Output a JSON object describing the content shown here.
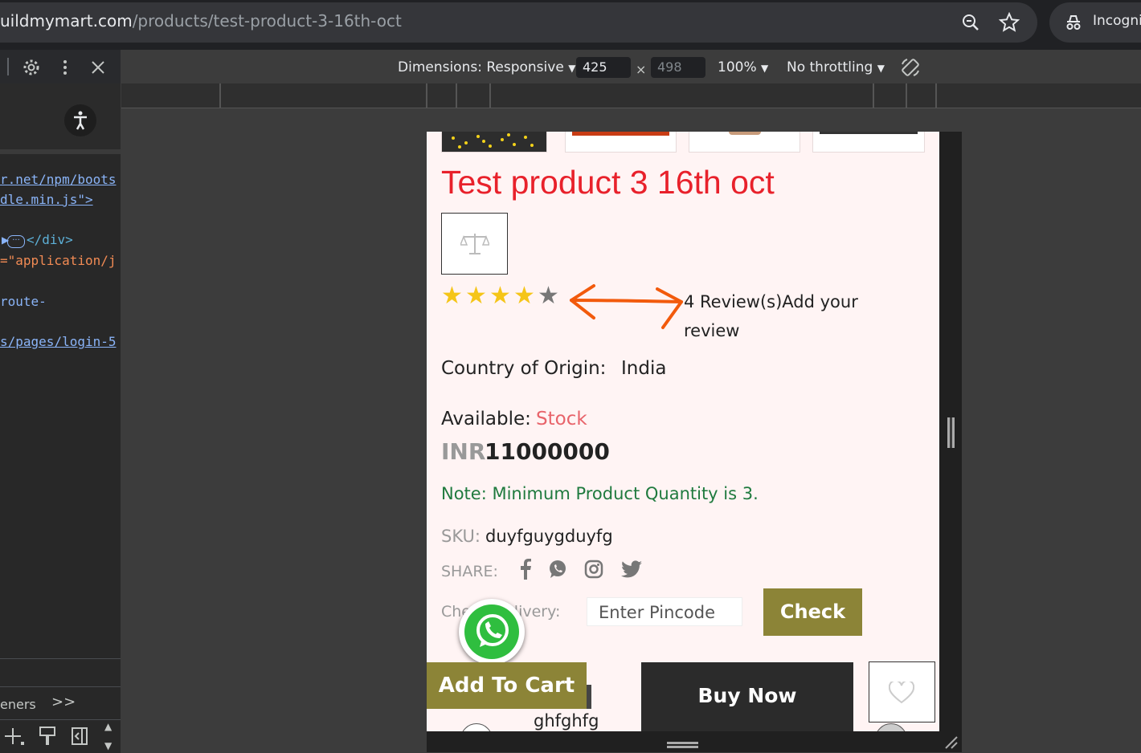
{
  "browser": {
    "url_host": "uildmymart.com",
    "url_path": "/products/test-product-3-16th-oct",
    "incognito_label": "Incogni"
  },
  "devtools": {
    "code_lines": [
      {
        "text": "r.net/npm/boots",
        "kind": "link"
      },
      {
        "text": "dle.min.js\">",
        "kind": "link"
      },
      {
        "text": "</div>",
        "kind": "tag"
      },
      {
        "text": "=\"application/j",
        "kind": "str"
      },
      {
        "text": "route-",
        "kind": "link"
      },
      {
        "text": "s/pages/login-5",
        "kind": "link"
      }
    ],
    "listeners_label": "eners",
    "more_label": ">>"
  },
  "device_toolbar": {
    "dimensions_label": "Dimensions: Responsive",
    "width": "425",
    "height": "498",
    "times": "×",
    "zoom": "100%",
    "throttling": "No throttling"
  },
  "product": {
    "title": "Test product 3 16th oct",
    "rating": 4,
    "rating_max": 5,
    "reviews_text": "4 Review(s)Add your review",
    "country_label": "Country of Origin:",
    "country_value": "India",
    "available_label": "Available:",
    "available_value": "Stock",
    "price_currency": "INR",
    "price_value": "11000000",
    "note": "Note: Minimum Product Quantity is 3.",
    "sku_label": "SKU:",
    "sku_value": "duyfguygduyfg",
    "share_label": "SHARE:",
    "delivery_label": "Check Delivery:",
    "pincode_placeholder": "Enter Pincode",
    "check_label": "Check",
    "add_to_cart_label": "Add To Cart",
    "buy_now_label": "Buy Now",
    "related_text": "ghfghfg"
  },
  "colors": {
    "title_red": "#e8212b",
    "olive_button": "#8c8437",
    "note_green": "#1f7a3e",
    "star_gold": "#f5c518",
    "annotation_orange": "#f25a0c"
  }
}
